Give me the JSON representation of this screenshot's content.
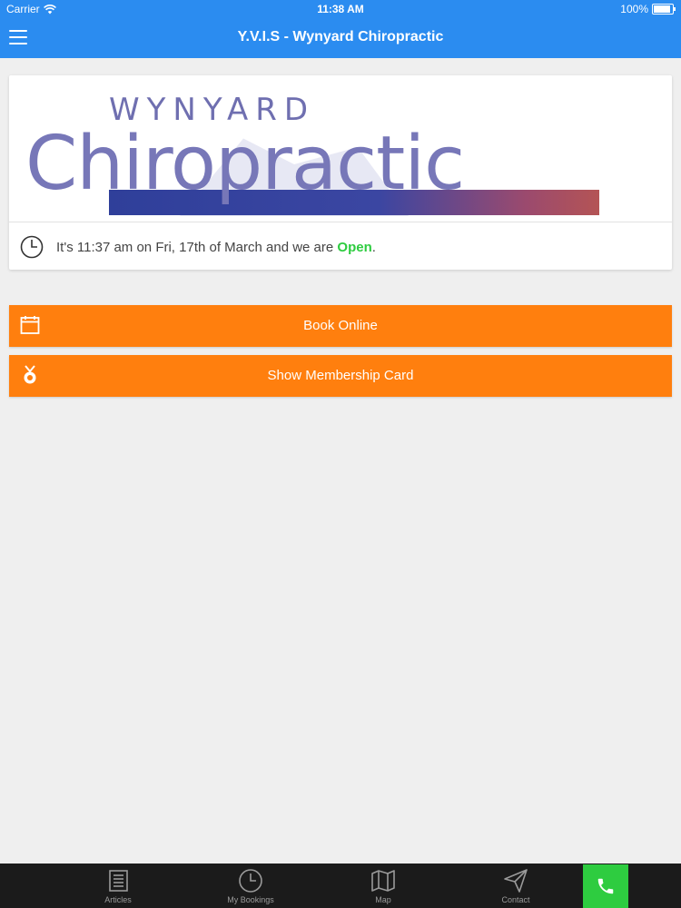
{
  "status_bar": {
    "carrier": "Carrier",
    "time": "11:38 AM",
    "battery": "100%"
  },
  "navbar": {
    "title": "Y.V.I.S - Wynyard Chiropractic"
  },
  "logo": {
    "top_text": "WYNYARD",
    "main_text": "Chiropractic"
  },
  "status_message": {
    "prefix": "It's 11:37 am on Fri, 17th of March and we are ",
    "state": "Open",
    "suffix": "."
  },
  "buttons": [
    {
      "label": "Book Online",
      "icon": "calendar-icon"
    },
    {
      "label": "Show Membership Card",
      "icon": "medal-icon"
    }
  ],
  "tabs": [
    {
      "label": "Articles",
      "icon": "articles-icon"
    },
    {
      "label": "My Bookings",
      "icon": "clock-icon"
    },
    {
      "label": "Map",
      "icon": "map-icon"
    },
    {
      "label": "Contact",
      "icon": "send-icon"
    }
  ],
  "call_button": {
    "icon": "phone-icon"
  },
  "colors": {
    "nav": "#2b8cf0",
    "accent": "#ff7f0e",
    "open": "#2ecc40",
    "tabbar": "#1b1b1b"
  }
}
